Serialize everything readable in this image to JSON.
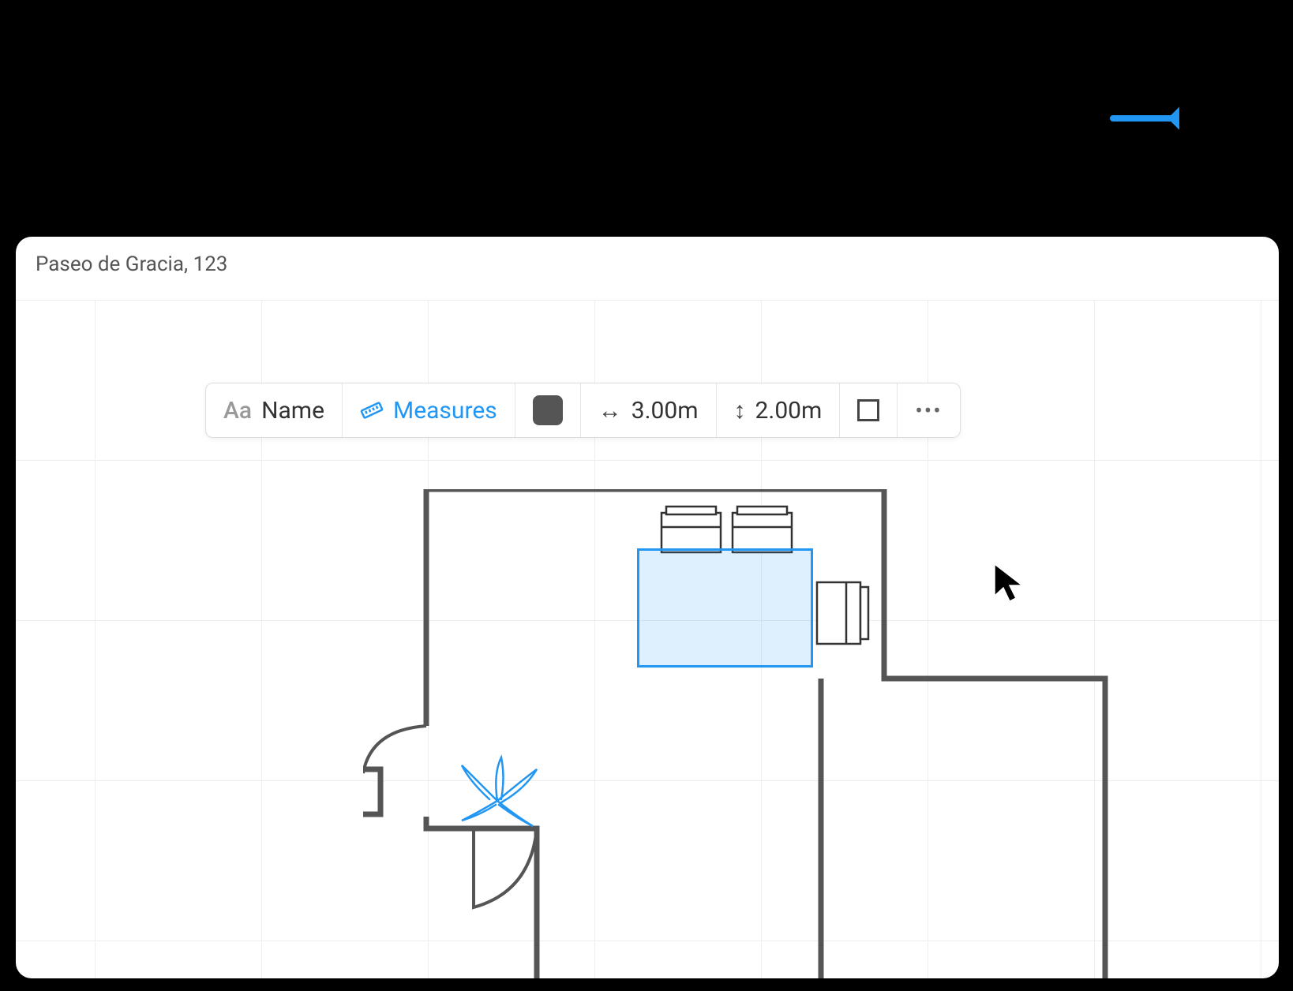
{
  "window": {
    "title": "Paseo de Gracia, 123"
  },
  "toolbar": {
    "name_icon": "Aa",
    "name_label": "Name",
    "measures_label": "Measures",
    "width_value": "3.00m",
    "height_value": "2.00m"
  },
  "colors": {
    "accent": "#2196F3",
    "swatch": "#555555"
  }
}
